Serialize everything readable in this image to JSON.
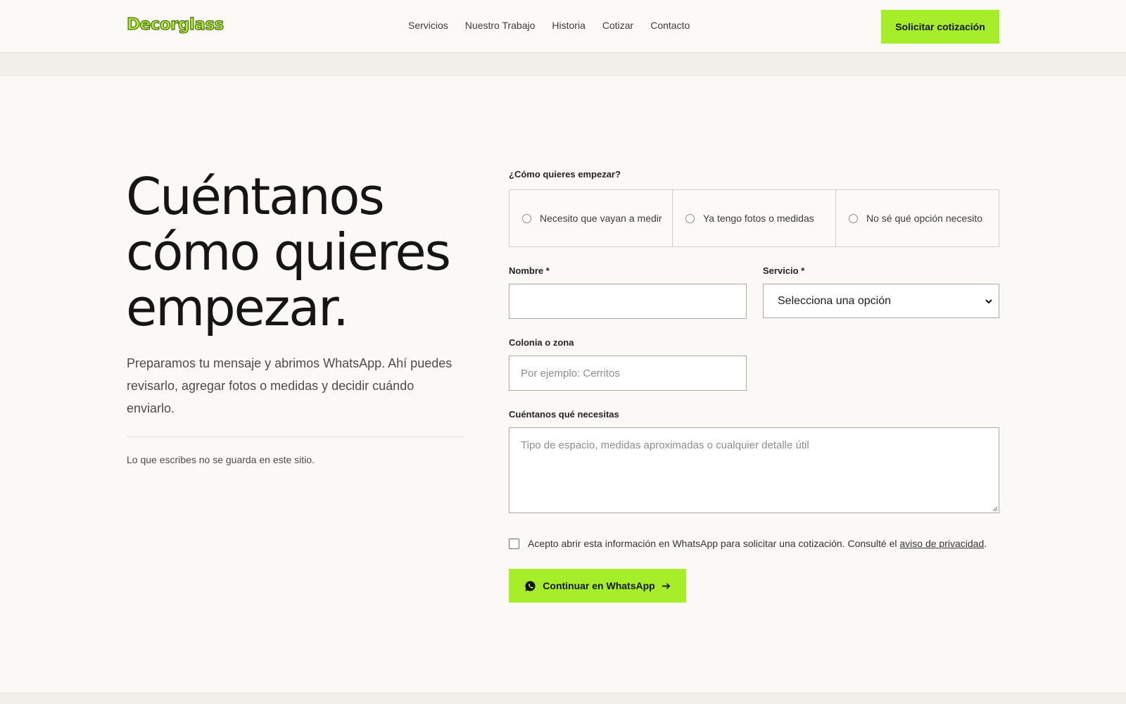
{
  "header": {
    "logo": "Decorglass",
    "nav": [
      "Servicios",
      "Nuestro Trabajo",
      "Historia",
      "Cotizar",
      "Contacto"
    ],
    "cta": "Solicitar cotización"
  },
  "hero": {
    "title_lines": [
      "Cuéntanos",
      "cómo quieres",
      "empezar."
    ],
    "subtitle": "Preparamos tu mensaje y abrimos WhatsApp. Ahí puedes revisarlo, agregar fotos o medidas y decidir cuándo enviarlo.",
    "note": "Lo que escribes no se guarda en este sitio."
  },
  "form": {
    "start_label": "¿Cómo quieres empezar?",
    "start_options": [
      "Necesito que vayan a medir",
      "Ya tengo fotos o medidas",
      "No sé qué opción necesito"
    ],
    "name_label": "Nombre *",
    "name_value": "",
    "service_label": "Servicio *",
    "service_selected": "Selecciona una opción",
    "zone_label": "Colonia o zona",
    "zone_placeholder": "Por ejemplo: Cerritos",
    "needs_label": "Cuéntanos qué necesitas",
    "needs_placeholder": "Tipo de espacio, medidas aproximadas o cualquier detalle útil",
    "consent_text": "Acepto abrir esta información en WhatsApp para solicitar una cotización. Consulté el ",
    "consent_link": "aviso de privacidad",
    "consent_end": ".",
    "submit": "Continuar en WhatsApp"
  },
  "colors": {
    "accent": "#a6ee2a",
    "background": "#faf9f6",
    "text": "#151515"
  },
  "icons": {
    "submit_left": "whatsapp-icon",
    "submit_right": "arrow-right-icon",
    "select": "chevron-down-icon"
  }
}
